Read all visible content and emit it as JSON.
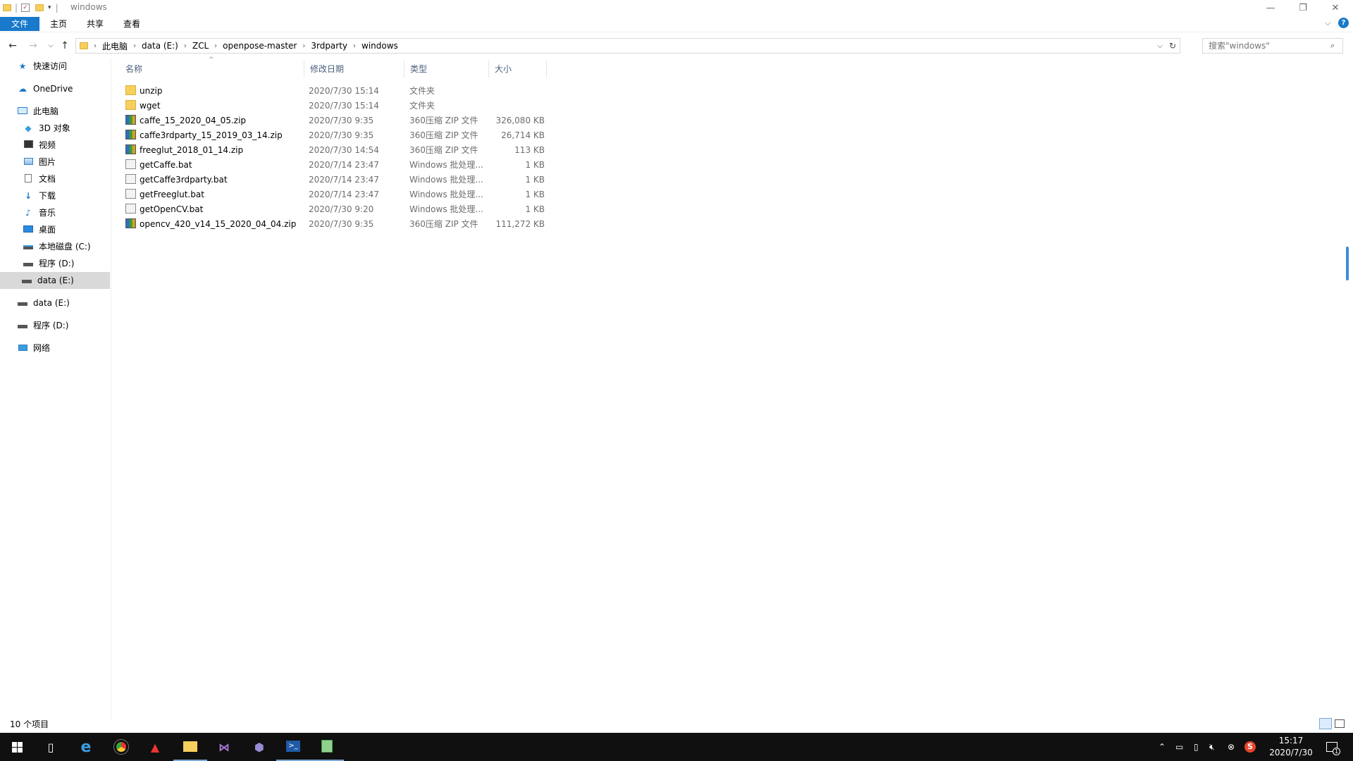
{
  "window": {
    "title": "windows",
    "controls": {
      "minimize": "—",
      "restore": "❐",
      "close": "✕"
    }
  },
  "ribbon": {
    "tabs": [
      "文件",
      "主页",
      "共享",
      "查看"
    ]
  },
  "address": {
    "crumbs": [
      "此电脑",
      "data (E:)",
      "ZCL",
      "openpose-master",
      "3rdparty",
      "windows"
    ],
    "search_placeholder": "搜索\"windows\""
  },
  "sidebar": {
    "items": [
      {
        "label": "快速访问",
        "icon": "star-icon",
        "selected": false
      },
      {
        "label": "OneDrive",
        "icon": "cloud-icon",
        "selected": false
      },
      {
        "label": "此电脑",
        "icon": "computer-icon",
        "selected": false
      },
      {
        "label": "3D 对象",
        "icon": "cube-icon",
        "selected": false
      },
      {
        "label": "视频",
        "icon": "video-icon",
        "selected": false
      },
      {
        "label": "图片",
        "icon": "picture-icon",
        "selected": false
      },
      {
        "label": "文档",
        "icon": "document-icon",
        "selected": false
      },
      {
        "label": "下载",
        "icon": "download-icon",
        "selected": false
      },
      {
        "label": "音乐",
        "icon": "music-icon",
        "selected": false
      },
      {
        "label": "桌面",
        "icon": "desktop-icon",
        "selected": false
      },
      {
        "label": "本地磁盘 (C:)",
        "icon": "drive-icon",
        "selected": false
      },
      {
        "label": "程序 (D:)",
        "icon": "drive-icon",
        "selected": false
      },
      {
        "label": "data (E:)",
        "icon": "drive-icon",
        "selected": true
      },
      {
        "label": "data (E:)",
        "icon": "drive-icon",
        "selected": false
      },
      {
        "label": "程序 (D:)",
        "icon": "drive-icon",
        "selected": false
      },
      {
        "label": "网络",
        "icon": "network-icon",
        "selected": false
      }
    ]
  },
  "columns": [
    "名称",
    "修改日期",
    "类型",
    "大小"
  ],
  "files": [
    {
      "name": "unzip",
      "date": "2020/7/30 15:14",
      "type": "文件夹",
      "size": "",
      "kind": "folder"
    },
    {
      "name": "wget",
      "date": "2020/7/30 15:14",
      "type": "文件夹",
      "size": "",
      "kind": "folder"
    },
    {
      "name": "caffe_15_2020_04_05.zip",
      "date": "2020/7/30 9:35",
      "type": "360压缩 ZIP 文件",
      "size": "326,080 KB",
      "kind": "zip"
    },
    {
      "name": "caffe3rdparty_15_2019_03_14.zip",
      "date": "2020/7/30 9:35",
      "type": "360压缩 ZIP 文件",
      "size": "26,714 KB",
      "kind": "zip"
    },
    {
      "name": "freeglut_2018_01_14.zip",
      "date": "2020/7/30 14:54",
      "type": "360压缩 ZIP 文件",
      "size": "113 KB",
      "kind": "zip"
    },
    {
      "name": "getCaffe.bat",
      "date": "2020/7/14 23:47",
      "type": "Windows 批处理...",
      "size": "1 KB",
      "kind": "bat"
    },
    {
      "name": "getCaffe3rdparty.bat",
      "date": "2020/7/14 23:47",
      "type": "Windows 批处理...",
      "size": "1 KB",
      "kind": "bat"
    },
    {
      "name": "getFreeglut.bat",
      "date": "2020/7/14 23:47",
      "type": "Windows 批处理...",
      "size": "1 KB",
      "kind": "bat"
    },
    {
      "name": "getOpenCV.bat",
      "date": "2020/7/30 9:20",
      "type": "Windows 批处理...",
      "size": "1 KB",
      "kind": "bat"
    },
    {
      "name": "opencv_420_v14_15_2020_04_04.zip",
      "date": "2020/7/30 9:35",
      "type": "360压缩 ZIP 文件",
      "size": "111,272 KB",
      "kind": "zip"
    }
  ],
  "status": {
    "count": "10 个项目"
  },
  "taskbar": {
    "clock_time": "15:17",
    "clock_date": "2020/7/30",
    "notification_count": "1",
    "apps": [
      "start-icon",
      "task-view-icon",
      "edge-icon",
      "chrome-icon",
      "app-triangle-icon",
      "file-explorer-icon",
      "visual-studio-icon",
      "app-cube-icon",
      "powershell-icon",
      "notepad-icon"
    ]
  },
  "colors": {
    "accent": "#1979ca",
    "selected_bg": "#d9d9d9",
    "taskbar_bg": "#101010"
  }
}
